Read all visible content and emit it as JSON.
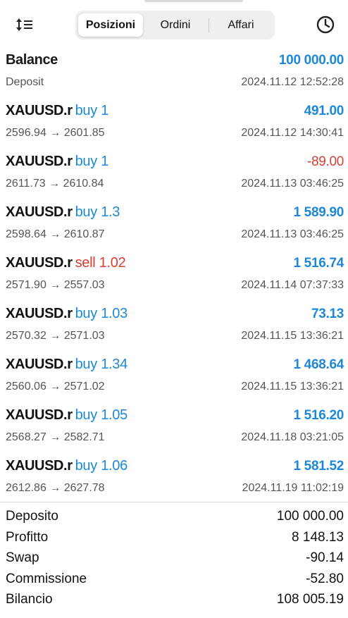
{
  "tabs": [
    {
      "label": "Posizioni",
      "active": true
    },
    {
      "label": "Ordini",
      "active": false
    },
    {
      "label": "Affari",
      "active": false
    }
  ],
  "balance": {
    "title": "Balance",
    "amount": "100 000.00",
    "type": "Deposit",
    "time": "2024.11.12 12:52:28"
  },
  "deals": [
    {
      "symbol": "XAUUSD.r",
      "direction": "buy 1",
      "side": "buy",
      "prices": "2596.94 → 2601.85",
      "profit": "491.00",
      "negative": false,
      "time": "2024.11.12 14:30:41"
    },
    {
      "symbol": "XAUUSD.r",
      "direction": "buy 1",
      "side": "buy",
      "prices": "2611.73 → 2610.84",
      "profit": "-89.00",
      "negative": true,
      "time": "2024.11.13 03:46:25"
    },
    {
      "symbol": "XAUUSD.r",
      "direction": "buy 1.3",
      "side": "buy",
      "prices": "2598.64 → 2610.87",
      "profit": "1 589.90",
      "negative": false,
      "time": "2024.11.13 03:46:25"
    },
    {
      "symbol": "XAUUSD.r",
      "direction": "sell 1.02",
      "side": "sell",
      "prices": "2571.90 → 2557.03",
      "profit": "1 516.74",
      "negative": false,
      "time": "2024.11.14 07:37:33"
    },
    {
      "symbol": "XAUUSD.r",
      "direction": "buy 1.03",
      "side": "buy",
      "prices": "2570.32 → 2571.03",
      "profit": "73.13",
      "negative": false,
      "time": "2024.11.15 13:36:21"
    },
    {
      "symbol": "XAUUSD.r",
      "direction": "buy 1.34",
      "side": "buy",
      "prices": "2560.06 → 2571.02",
      "profit": "1 468.64",
      "negative": false,
      "time": "2024.11.15 13:36:21"
    },
    {
      "symbol": "XAUUSD.r",
      "direction": "buy 1.05",
      "side": "buy",
      "prices": "2568.27 → 2582.71",
      "profit": "1 516.20",
      "negative": false,
      "time": "2024.11.18 03:21:05"
    },
    {
      "symbol": "XAUUSD.r",
      "direction": "buy 1.06",
      "side": "buy",
      "prices": "2612.86 → 2627.78",
      "profit": "1 581.52",
      "negative": false,
      "time": "2024.11.19 11:02:19"
    }
  ],
  "summary": [
    {
      "label": "Deposito",
      "value": "100 000.00"
    },
    {
      "label": "Profitto",
      "value": "8 148.13"
    },
    {
      "label": "Swap",
      "value": "-90.14"
    },
    {
      "label": "Commissione",
      "value": "-52.80"
    },
    {
      "label": "Bilancio",
      "value": "108 005.19"
    }
  ],
  "icons": {
    "sort": "sort-icon",
    "history": "clock-icon"
  },
  "colors": {
    "buy": "#1e88d8",
    "sell": "#d63f31",
    "profit_positive": "#1e88d8",
    "profit_negative": "#d63f31"
  }
}
